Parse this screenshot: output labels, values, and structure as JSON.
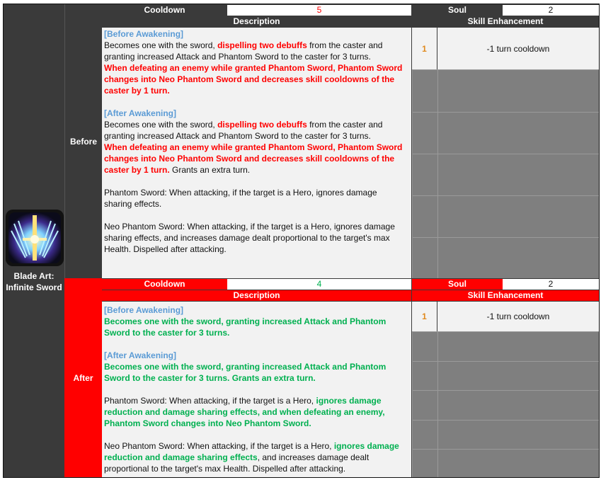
{
  "skill": {
    "name_line1": "Blade Art:",
    "name_line2": "Infinite Sword",
    "icon": "sword-wings-icon"
  },
  "headers": {
    "cooldown": "Cooldown",
    "soul": "Soul",
    "description": "Description",
    "skill_enhancement": "Skill Enhancement"
  },
  "before": {
    "label": "Before",
    "cooldown_value": "5",
    "soul_value": "2",
    "enhancement": {
      "level": "1",
      "text": "-1 turn cooldown"
    },
    "desc": {
      "b_title": "[Before Awakening]",
      "b1a": "Becomes one with the sword, ",
      "b1b": "dispelling two debuffs",
      "b1c": " from the caster and",
      "b2": "granting increased Attack and Phantom Sword to the caster for 3 turns.",
      "b3": "When defeating an enemy while granted Phantom Sword, Phantom Sword",
      "b4": "changes into Neo Phantom Sword and decreases skill cooldowns of the",
      "b5": "caster by 1 turn.",
      "a_title": "[After Awakening]",
      "a1a": "Becomes one with the sword, ",
      "a1b": "dispelling two debuffs",
      "a1c": " from the caster and",
      "a2": "granting increased Attack and Phantom Sword to the caster for 3 turns.",
      "a3": "When defeating an enemy while granted Phantom Sword, Phantom Sword",
      "a4": "changes into Neo Phantom Sword and decreases skill cooldowns of the",
      "a5a": "caster by 1 turn.",
      "a5b": " Grants an extra turn.",
      "p1": "Phantom Sword: When attacking, if the target is a Hero, ignores damage",
      "p2": "sharing effects.",
      "n1": "Neo Phantom Sword: When attacking, if the target is a Hero, ignores damage",
      "n2": "sharing effects, and increases damage dealt proportional to the target's max",
      "n3": "Health. Dispelled after attacking."
    }
  },
  "after": {
    "label": "After",
    "cooldown_value": "4",
    "soul_value": "2",
    "enhancement": {
      "level": "1",
      "text": "-1 turn cooldown"
    },
    "desc": {
      "b_title": "[Before Awakening]",
      "b1": "Becomes one with the sword, granting increased Attack and Phantom",
      "b2": "Sword to the caster for 3 turns.",
      "a_title": "[After Awakening]",
      "a1": "Becomes one with the sword, granting increased Attack and Phantom",
      "a2": "Sword to the caster for 3 turns. Grants an extra turn.",
      "p1a": "Phantom Sword: When attacking, if the target is a Hero, ",
      "p1b": "ignores damage",
      "p2": "reduction and damage sharing effects, and when defeating an enemy,",
      "p3": "Phantom Sword changes into Neo Phantom Sword.",
      "n1a": "Neo Phantom Sword: When attacking, if the target is a Hero, ",
      "n1b": "ignores damage",
      "n2a": "reduction and damage sharing effects",
      "n2b": ", and increases damage dealt",
      "n3": "proportional to the target's max Health. Dispelled after attacking."
    }
  },
  "colors": {
    "dark": "#3a3a3a",
    "accent_red": "#ff0000",
    "green_text": "#00b050",
    "blue_text": "#5b9bd5",
    "grid_gray": "#7f7f7f",
    "level_orange": "#e08a1e"
  }
}
